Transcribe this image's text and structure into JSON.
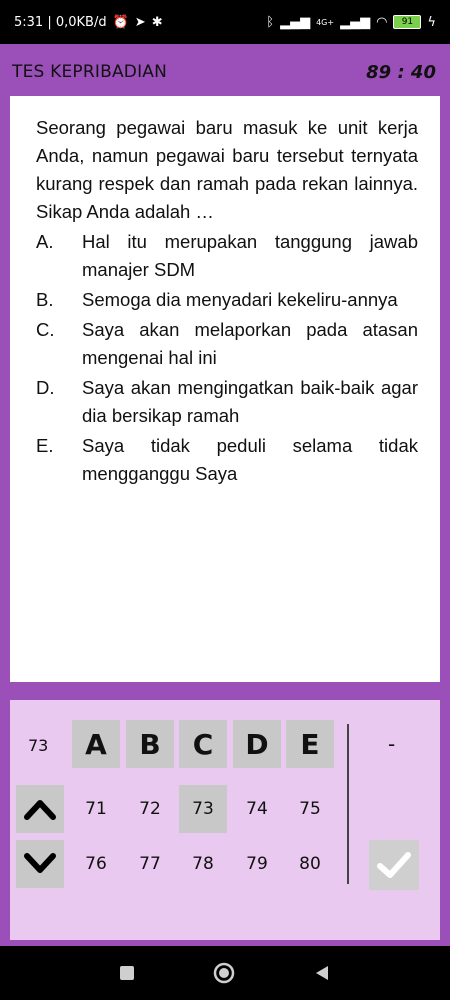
{
  "status": {
    "time_info": "5:31 | 0,0KB/d",
    "network": "4G+",
    "battery": "91"
  },
  "header": {
    "title": "TES KEPRIBADIAN",
    "timer": "89 : 40"
  },
  "question": {
    "text": "Seorang pegawai baru masuk ke unit kerja Anda, namun pegawai baru tersebut ternyata kurang respek dan ramah pada rekan lainnya. Sikap Anda adalah …",
    "options": [
      {
        "letter": "A.",
        "text": "Hal itu merupakan tanggung jawab manajer SDM"
      },
      {
        "letter": "B.",
        "text": "Semoga dia menyadari kekeliru-annya"
      },
      {
        "letter": "C.",
        "text": "Saya akan melaporkan pada atasan mengenai hal ini"
      },
      {
        "letter": "D.",
        "text": "Saya akan mengingatkan baik-baik agar dia bersikap ramah"
      },
      {
        "letter": "E.",
        "text": "Saya tidak peduli selama tidak mengganggu Saya"
      }
    ]
  },
  "navigator": {
    "current_number": "73",
    "answer_buttons": [
      "A",
      "B",
      "C",
      "D",
      "E"
    ],
    "selected_answer": "-",
    "row1": [
      "71",
      "72",
      "73",
      "74",
      "75"
    ],
    "row2": [
      "76",
      "77",
      "78",
      "79",
      "80"
    ],
    "active_number": "73"
  },
  "colors": {
    "background": "#9b4fb8",
    "panel": "#e9c9ef",
    "button": "#c8c8c8"
  },
  "icons": {
    "up": "chevron-up-icon",
    "down": "chevron-down-icon",
    "submit": "check-icon"
  }
}
